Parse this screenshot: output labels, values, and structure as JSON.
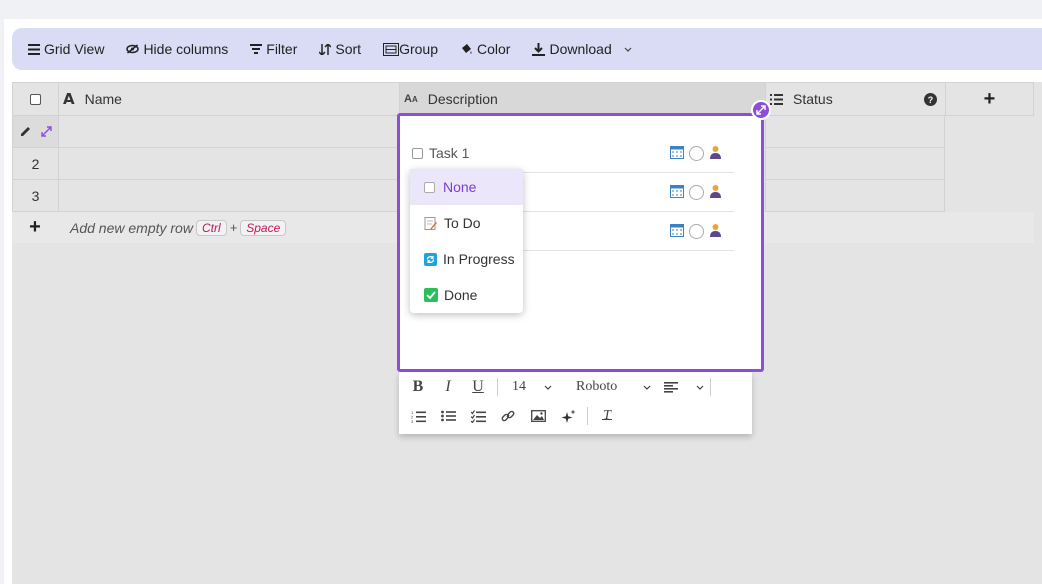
{
  "toolbar": {
    "grid_view": "Grid View",
    "hide_columns": "Hide columns",
    "filter": "Filter",
    "sort": "Sort",
    "group": "Group",
    "color": "Color",
    "download": "Download"
  },
  "columns": {
    "name": "Name",
    "description": "Description",
    "status": "Status",
    "add": "+"
  },
  "rows": [
    "2",
    "3"
  ],
  "add_row": {
    "plus": "+",
    "label": "Add new empty row",
    "key1": "Ctrl",
    "joiner": "+",
    "key2": "Space"
  },
  "editor": {
    "tasks": [
      {
        "text": "Task 1"
      }
    ]
  },
  "status_dropdown": {
    "options": [
      "None",
      "To Do",
      "In Progress",
      "Done"
    ],
    "selected": "None"
  },
  "format_bar": {
    "font_size": "14",
    "font_family": "Roboto",
    "bold": "B",
    "italic": "I",
    "underline": "U",
    "clear": "T"
  },
  "colors": {
    "accent": "#8b4fd8",
    "toolbar_bg": "#d9dcf4",
    "grid_bg": "#e4e4e4"
  }
}
